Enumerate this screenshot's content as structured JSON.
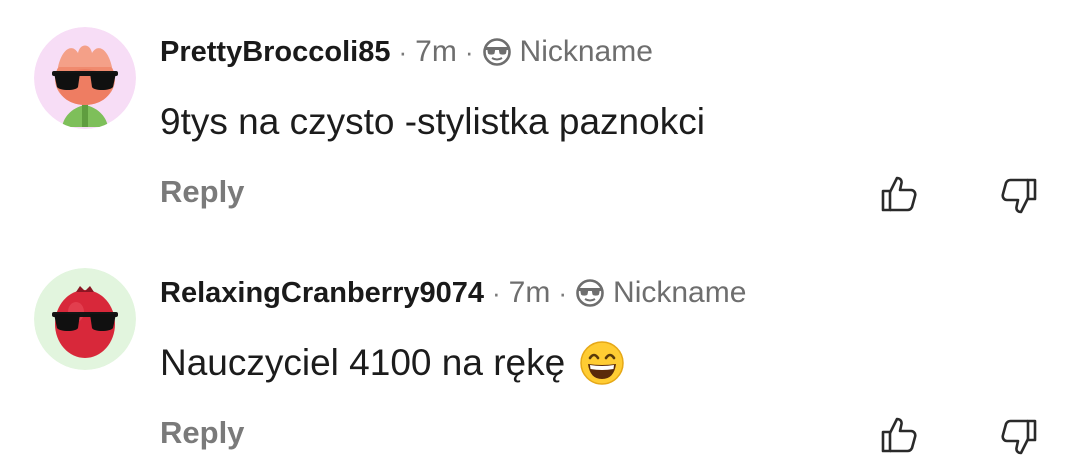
{
  "comments": [
    {
      "username": "PrettyBroccoli85",
      "time": "7m",
      "separator": "·",
      "badge_label": "Nickname",
      "badge_icon": "sunglasses-face-icon",
      "text": "9tys na czysto -stylistka paznokci",
      "reply_label": "Reply",
      "avatar": "tulip-with-sunglasses-avatar",
      "avatar_bg": "#f7ddf6"
    },
    {
      "username": "RelaxingCranberry9074",
      "time": "7m",
      "separator": "·",
      "badge_label": "Nickname",
      "badge_icon": "sunglasses-face-icon",
      "text": "Nauczyciel 4100 na rękę",
      "text_emoji": "grinning-squinting-face-emoji",
      "reply_label": "Reply",
      "avatar": "cranberry-with-sunglasses-avatar",
      "avatar_bg": "#e2f5de"
    }
  ],
  "colors": {
    "text": "#1c1c1c",
    "muted": "#6e6e6e",
    "reply": "#7a7a7a"
  }
}
